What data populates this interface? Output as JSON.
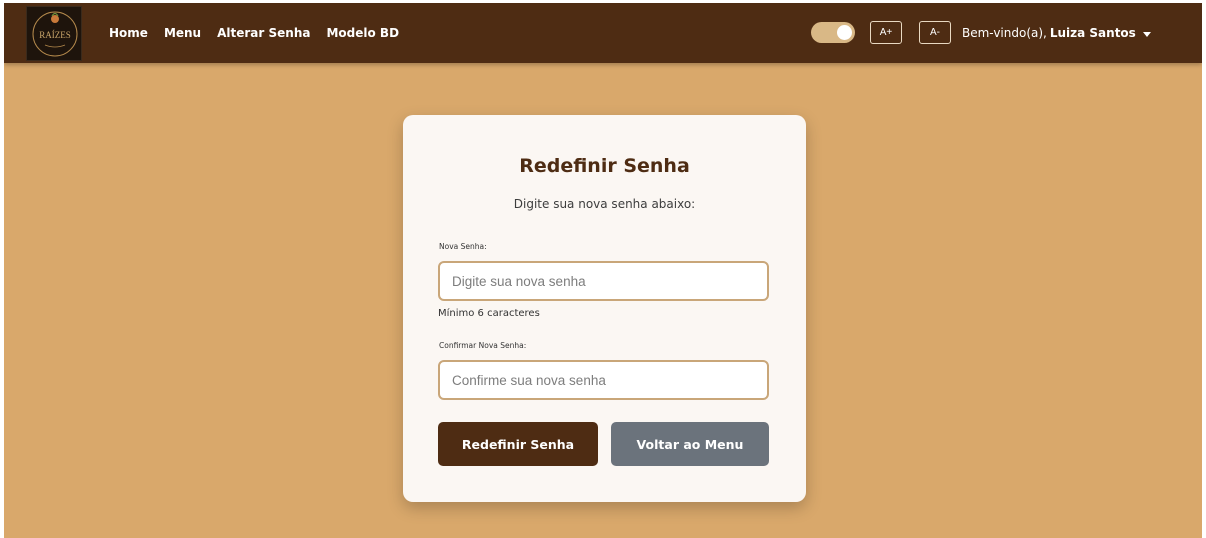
{
  "navbar": {
    "logo_text": "RAÍZES",
    "links": [
      "Home",
      "Menu",
      "Alterar Senha",
      "Modelo BD"
    ],
    "font_increase_label": "A+",
    "font_decrease_label": "A-",
    "theme_toggle_on": true,
    "welcome_prefix": "Bem-vindo(a),",
    "user_name": "Luiza Santos"
  },
  "card": {
    "title": "Redefinir Senha",
    "subtitle": "Digite sua nova senha abaixo:",
    "new_password": {
      "label": "Nova Senha:",
      "placeholder": "Digite sua nova senha",
      "value": "",
      "hint": "Mínimo 6 caracteres"
    },
    "confirm_password": {
      "label": "Confirmar Nova Senha:",
      "placeholder": "Confirme sua nova senha",
      "value": ""
    },
    "submit_label": "Redefinir Senha",
    "back_label": "Voltar ao Menu"
  },
  "colors": {
    "background": "#d9a86b",
    "navbar": "#4e2c13",
    "primary_button": "#4e2c13",
    "secondary_button": "#6b737c",
    "input_border": "#c9a679"
  }
}
